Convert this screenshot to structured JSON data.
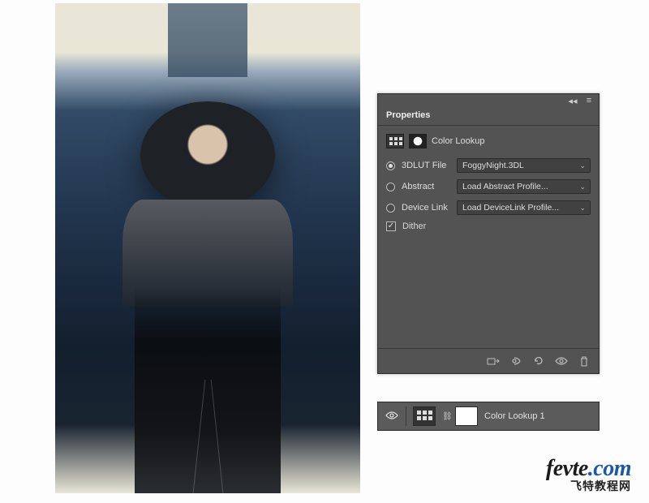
{
  "panel": {
    "title": "Properties",
    "adjustment_name": "Color Lookup",
    "options": {
      "lut": {
        "label": "3DLUT File",
        "value": "FoggyNight.3DL",
        "selected": true
      },
      "abstract": {
        "label": "Abstract",
        "value": "Load Abstract Profile...",
        "selected": false
      },
      "devicelink": {
        "label": "Device Link",
        "value": "Load DeviceLink Profile...",
        "selected": false
      }
    },
    "dither": {
      "label": "Dither",
      "checked": true
    }
  },
  "layer": {
    "name": "Color Lookup 1"
  },
  "watermark": {
    "brand": "fevte",
    "domain": ".com",
    "subtitle": "飞特教程网"
  }
}
